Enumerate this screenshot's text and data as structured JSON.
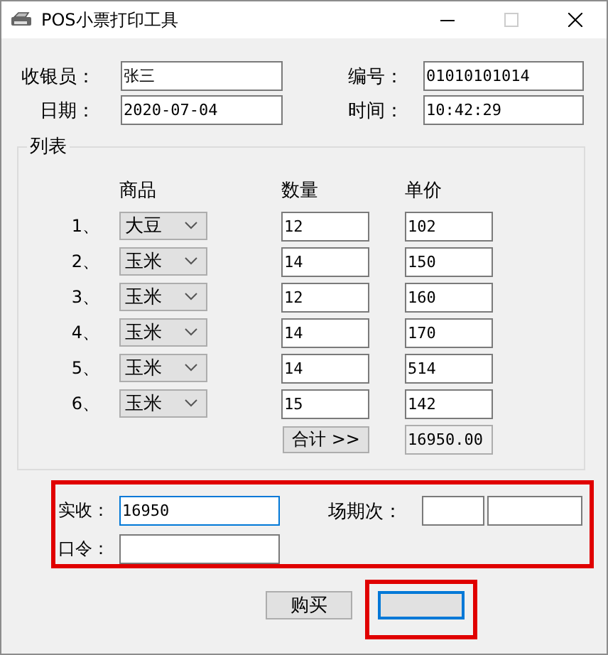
{
  "window": {
    "title": "POS小票打印工具"
  },
  "header_fields": [
    {
      "label": "收银员：",
      "value": "张三"
    },
    {
      "label": "编号：",
      "value": "01010101014"
    },
    {
      "label": "日期：",
      "value": "2020-07-04"
    },
    {
      "label": "时间：",
      "value": "10:42:29"
    }
  ],
  "list": {
    "title": "列表",
    "columns": [
      "商品",
      "数量",
      "单价"
    ],
    "rows": [
      {
        "index": "1、",
        "product": "大豆",
        "quantity": "12",
        "price": "102"
      },
      {
        "index": "2、",
        "product": "玉米",
        "quantity": "14",
        "price": "150"
      },
      {
        "index": "3、",
        "product": "玉米",
        "quantity": "12",
        "price": "160"
      },
      {
        "index": "4、",
        "product": "玉米",
        "quantity": "14",
        "price": "170"
      },
      {
        "index": "5、",
        "product": "玉米",
        "quantity": "14",
        "price": "514"
      },
      {
        "index": "6、",
        "product": "玉米",
        "quantity": "15",
        "price": "142"
      }
    ],
    "total_button": "合计 >>",
    "total": "16950.00"
  },
  "payment": {
    "received_label": "实收：",
    "received": "16950",
    "received_focused": true,
    "session_label": "场期次：",
    "password_label": "口令："
  },
  "buttons": [
    {
      "label": "购买",
      "focused": false
    },
    {
      "focused": true
    }
  ]
}
